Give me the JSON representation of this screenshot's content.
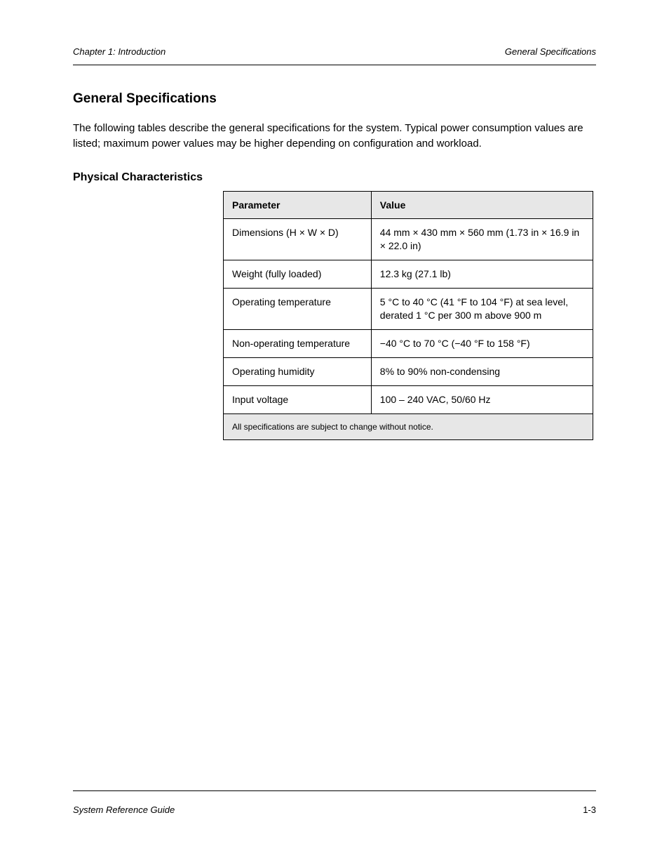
{
  "header": {
    "left": "Chapter 1: Introduction",
    "right": "General Specifications"
  },
  "section_title": "General Specifications",
  "intro_para": "The following tables describe the general specifications for the system. Typical power consumption values are listed; maximum power values may be higher depending on configuration and workload.",
  "table_title": "Physical Characteristics",
  "table": {
    "headers": [
      "Parameter",
      "Value"
    ],
    "rows": [
      {
        "param": "Dimensions (H × W × D)",
        "value": "44 mm × 430 mm × 560 mm\n(1.73 in × 16.9 in × 22.0 in)"
      },
      {
        "param": "Weight (fully loaded)",
        "value": "12.3 kg (27.1 lb)"
      },
      {
        "param": "Operating temperature",
        "value": "5 °C to 40 °C (41 °F to 104 °F) at sea level, derated 1 °C per 300 m above 900 m"
      },
      {
        "param": "Non-operating temperature",
        "value": "−40 °C to 70 °C (−40 °F to 158 °F)"
      },
      {
        "param": "Operating humidity",
        "value": "8% to 90% non-condensing"
      },
      {
        "param": "Input voltage",
        "value": "100 – 240 VAC, 50/60 Hz"
      }
    ],
    "footer": "All specifications are subject to change without notice."
  },
  "footer": {
    "left": "System Reference Guide",
    "right": "1-3"
  }
}
